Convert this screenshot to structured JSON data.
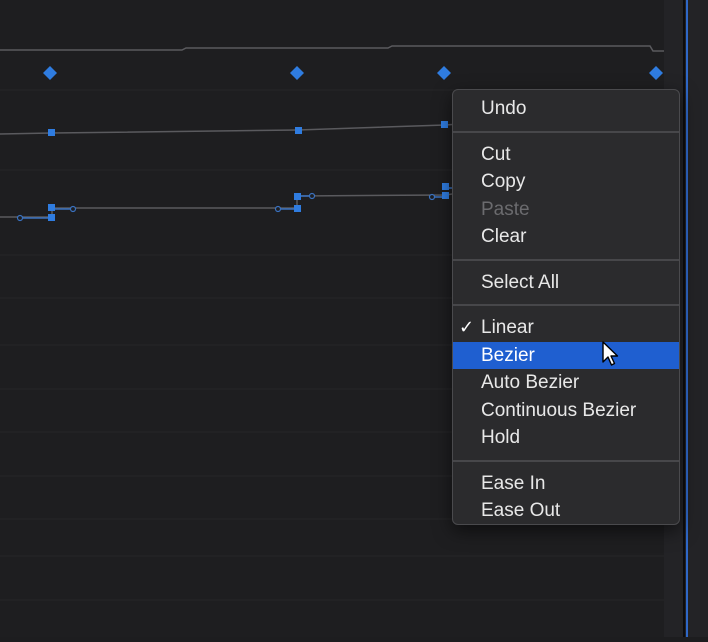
{
  "context_menu": {
    "items": [
      {
        "label": "Undo"
      },
      {
        "label": "Cut"
      },
      {
        "label": "Copy"
      },
      {
        "label": "Paste"
      },
      {
        "label": "Clear"
      },
      {
        "label": "Select All"
      },
      {
        "label": "Linear",
        "checked": true
      },
      {
        "label": "Bezier",
        "highlighted": true
      },
      {
        "label": "Auto Bezier"
      },
      {
        "label": "Continuous Bezier"
      },
      {
        "label": "Hold"
      },
      {
        "label": "Ease In"
      },
      {
        "label": "Ease Out"
      }
    ],
    "disabled_items": [
      "Paste"
    ]
  },
  "colors": {
    "background": "#1e1e20",
    "keyframe": "#2f7ce0",
    "curve": "#5a5a5e",
    "highlight": "#1f5fd0"
  },
  "icons": {
    "checkmark": "checkmark-icon",
    "cursor": "mouse-pointer-icon",
    "keyframe": "keyframe-diamond-icon"
  }
}
